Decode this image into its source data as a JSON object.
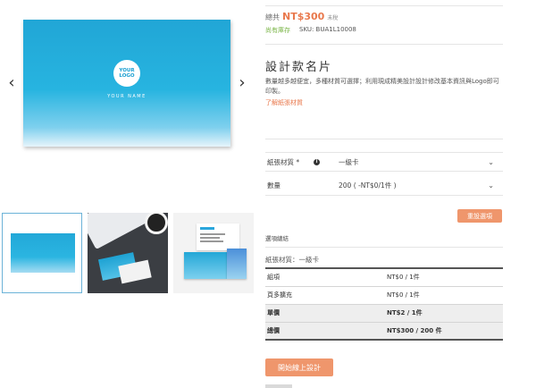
{
  "gallery": {
    "main_logo_text": "YOUR\nLOGO",
    "main_name_text": "YOUR NAME",
    "prev_arrow": "‹",
    "next_arrow": "›",
    "thumbnails": [
      "thumbnail-front",
      "thumbnail-desk",
      "thumbnail-mockup"
    ]
  },
  "product": {
    "price_prefix": "總共",
    "price": "NT$300",
    "tax_note": "未稅",
    "stock": "尚有庫存",
    "sku": "SKU: BUA1L10008",
    "title": "設計款名片",
    "description": "數量越多越便宜，多種材質可選擇；利用現成精美設計設計修改基本資訊與Logo即可印製。",
    "paper_link": "了解紙張材質"
  },
  "options": {
    "paper": {
      "label": "紙張材質 *",
      "value": "一級卡",
      "icon": "info-icon"
    },
    "quantity": {
      "label": "數量",
      "value": "200 ( -NT$0/1件 )"
    },
    "chevron": "⌄"
  },
  "reset_label": "重設選項",
  "spec": {
    "heading": "選項總結",
    "paper_summary": "紙張材質：一級卡"
  },
  "price_table": [
    {
      "label": "組項",
      "value": "NT$0 / 1件"
    },
    {
      "label": "頁多擴充",
      "value": "NT$0 / 1件"
    },
    {
      "label": "單價",
      "value": "NT$2 / 1件"
    },
    {
      "label": "總價",
      "value": "NT$300 / 200 件"
    }
  ],
  "design_button": "開始線上設計",
  "colors": {
    "accent": "#ef966c",
    "price": "#e9794d",
    "stock": "#7ab547",
    "card_blue": "#21a6d6"
  }
}
